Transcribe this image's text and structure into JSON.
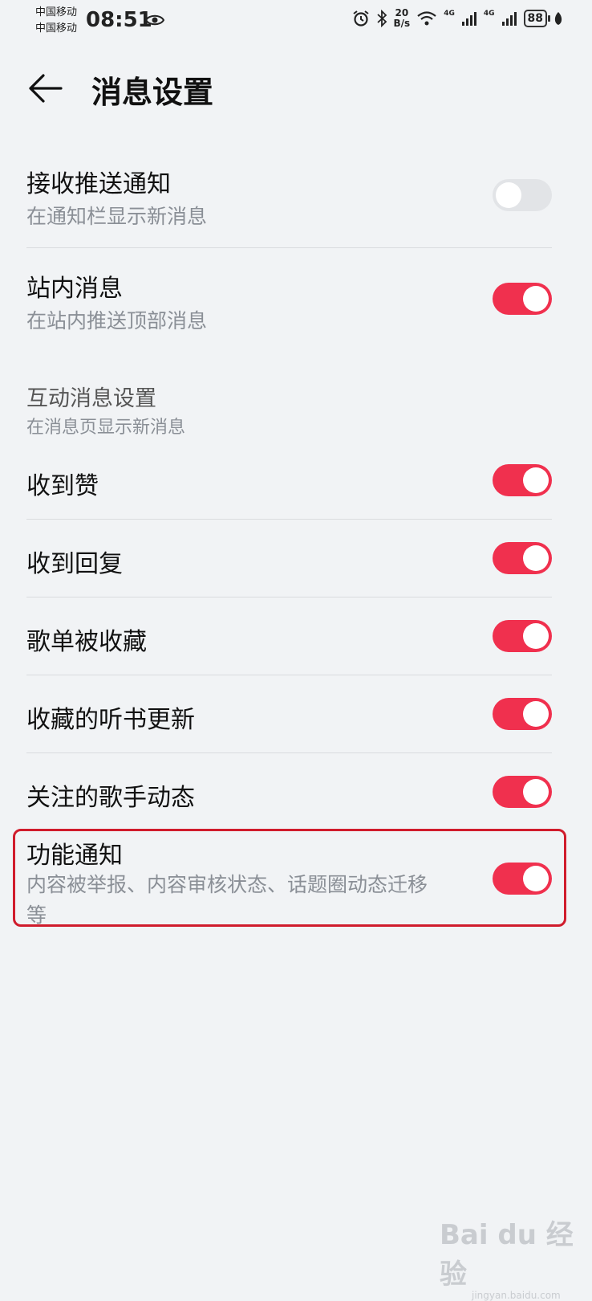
{
  "status_bar": {
    "carrier1": "中国移动",
    "carrier2": "中国移动",
    "time": "08:51",
    "speed_value": "20",
    "speed_unit": "B/s",
    "net1": "4G",
    "net2": "4G",
    "battery": "88"
  },
  "header": {
    "title": "消息设置"
  },
  "push": {
    "title": "接收推送通知",
    "subtitle": "在通知栏显示新消息",
    "enabled": false
  },
  "site": {
    "title": "站内消息",
    "subtitle": "在站内推送顶部消息",
    "enabled": true
  },
  "interaction": {
    "title": "互动消息设置",
    "subtitle": "在消息页显示新消息",
    "items": [
      {
        "label": "收到赞",
        "enabled": true
      },
      {
        "label": "收到回复",
        "enabled": true
      },
      {
        "label": "歌单被收藏",
        "enabled": true
      },
      {
        "label": "收藏的听书更新",
        "enabled": true
      },
      {
        "label": "关注的歌手动态",
        "enabled": true
      }
    ]
  },
  "feature": {
    "title": "功能通知",
    "subtitle_line1": "内容被举报、内容审核状态、话题圈动态迁移",
    "subtitle_line2": "等",
    "enabled": true
  },
  "watermark": {
    "brand": "Bai du 经验",
    "url": "jingyan.baidu.com"
  },
  "colors": {
    "toggle_on": "#f0304e",
    "toggle_off": "#e2e4e7",
    "highlight": "#d01c2c",
    "background": "#f1f3f5"
  }
}
